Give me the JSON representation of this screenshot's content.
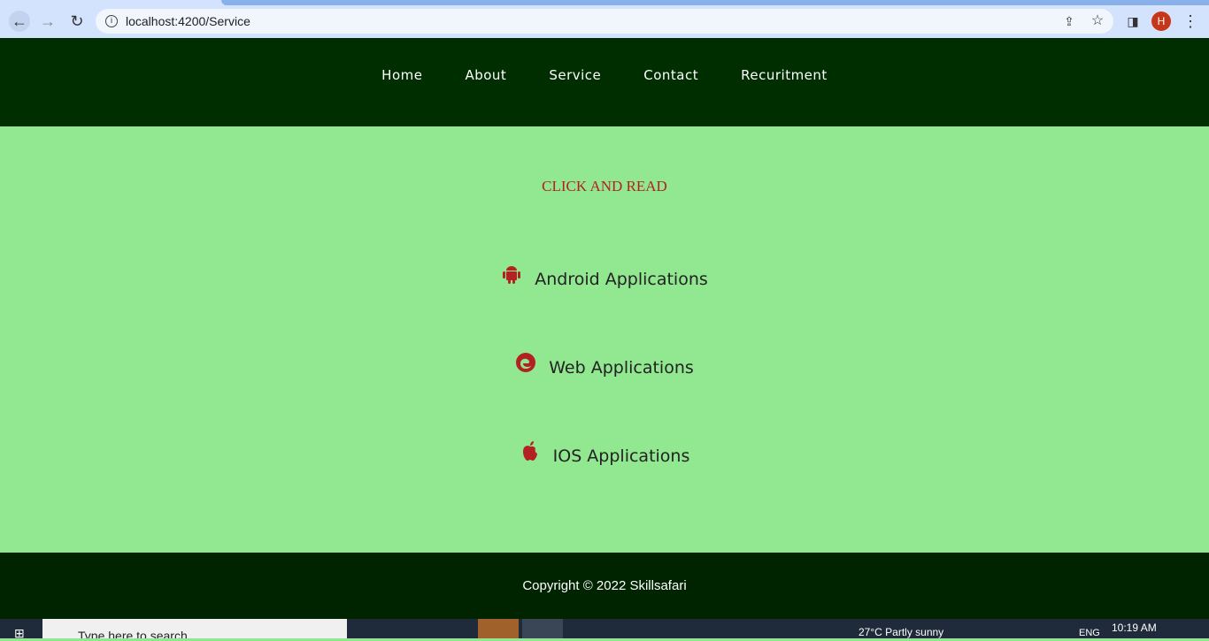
{
  "browser": {
    "url": "localhost:4200/Service",
    "profile_initial": "H"
  },
  "nav": {
    "items": [
      "Home",
      "About",
      "Service",
      "Contact",
      "Recuritment"
    ]
  },
  "main": {
    "title": "CLICK AND READ",
    "services": [
      {
        "label": "Android Applications",
        "icon": "android-icon"
      },
      {
        "label": "Web Applications",
        "icon": "edge-icon"
      },
      {
        "label": "IOS Applications",
        "icon": "apple-icon"
      }
    ]
  },
  "footer": {
    "text": "Copyright © 2022 Skillsafari"
  },
  "taskbar": {
    "search_placeholder": "Type here to search",
    "weather": "27°C  Partly sunny",
    "lang": "ENG",
    "time": "10:19 AM"
  },
  "colors": {
    "header": "#002e00",
    "body": "#92e890",
    "accent": "#b22222"
  }
}
